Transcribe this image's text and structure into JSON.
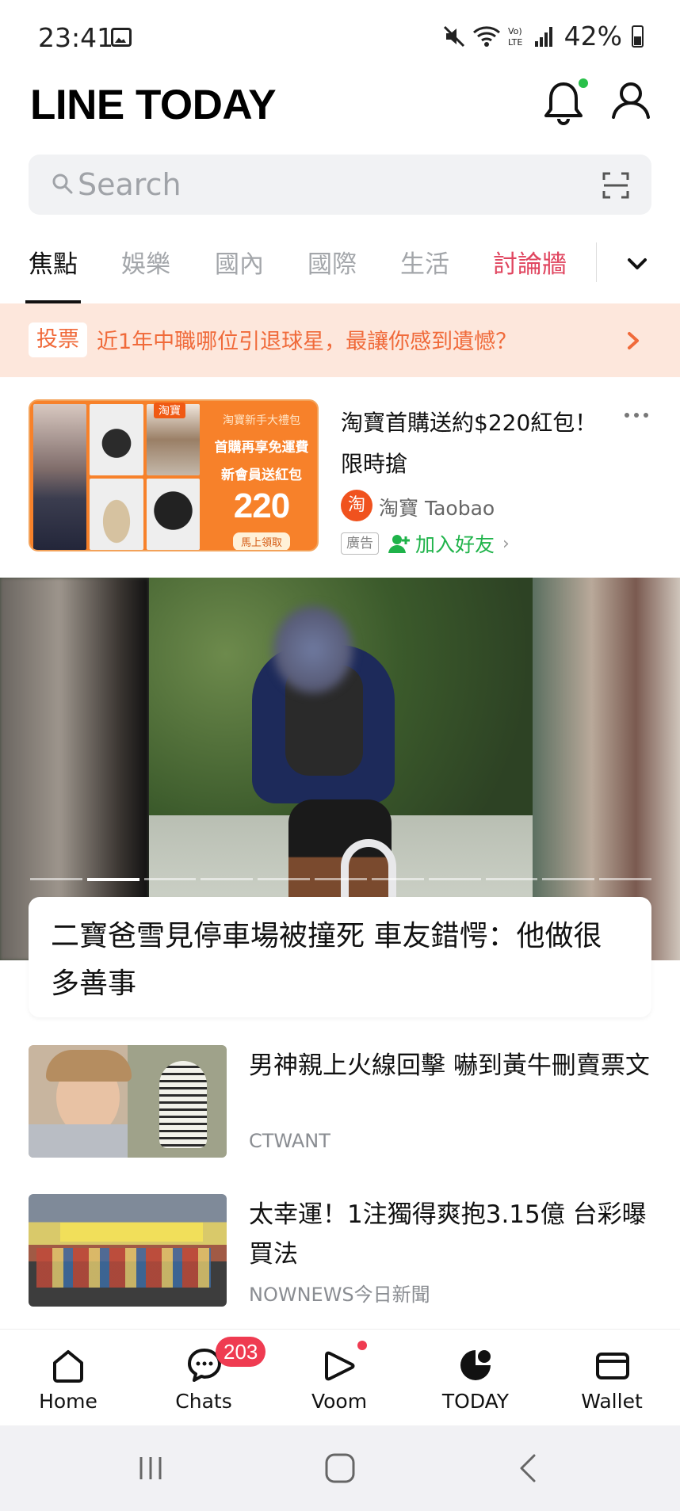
{
  "status": {
    "time": "23:41",
    "battery_pct": "42%"
  },
  "header": {
    "title": "LINE TODAY"
  },
  "search": {
    "placeholder": "Search"
  },
  "tabs": [
    {
      "label": "焦點"
    },
    {
      "label": "娛樂"
    },
    {
      "label": "國內"
    },
    {
      "label": "國際"
    },
    {
      "label": "生活"
    },
    {
      "label": "討論牆"
    }
  ],
  "vote": {
    "tag": "投票",
    "text": "近1年中職哪位引退球星，最讓你感到遺憾？"
  },
  "ad": {
    "badge": "淘寶",
    "panel_line1": "淘寶新手大禮包",
    "panel_line2": "首購再享免運費",
    "panel_line3": "新會員送紅包",
    "panel_amount": "220",
    "panel_button": "馬上領取",
    "title": "淘寶首購送約$220紅包！限時搶",
    "source_logo": "淘",
    "source": "淘寶 Taobao",
    "label": "廣告",
    "add_friend": "加入好友"
  },
  "hero": {
    "title": "二寶爸雪見停車場被撞死 車友錯愕：他做很多善事",
    "slide_count": 11,
    "active_slide": 2
  },
  "news": [
    {
      "title": "男神親上火線回擊 嚇到黃牛刪賣票文",
      "source": "CTWANT"
    },
    {
      "title": "太幸運！1注獨得爽抱3.15億 台彩曝買法",
      "source": "NOWNEWS今日新聞"
    }
  ],
  "bottom_nav": [
    {
      "label": "Home",
      "icon": "home-icon"
    },
    {
      "label": "Chats",
      "icon": "chat-icon",
      "badge": "203"
    },
    {
      "label": "Voom",
      "icon": "voom-icon"
    },
    {
      "label": "TODAY",
      "icon": "today-icon"
    },
    {
      "label": "Wallet",
      "icon": "wallet-icon"
    }
  ],
  "colors": {
    "accent_pink": "#e0455f",
    "vote_orange": "#f06a3a",
    "friend_green": "#1fb34a",
    "badge_red": "#ef3b51"
  }
}
